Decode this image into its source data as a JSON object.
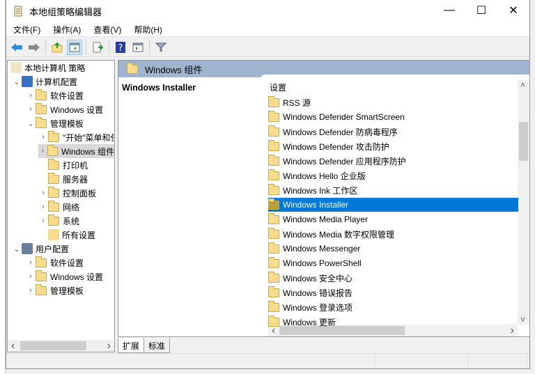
{
  "window": {
    "title": "本地组策略编辑器",
    "minimize": "—",
    "maximize": "☐",
    "close": "✕"
  },
  "menu": [
    "文件(F)",
    "操作(A)",
    "查看(V)",
    "帮助(H)"
  ],
  "toolbar": [
    "back-icon",
    "forward-icon",
    "up-folder-icon",
    "show-hide-tree-icon",
    "export-list-icon",
    "help-icon",
    "show-action-pane-icon",
    "filter-icon"
  ],
  "tree": [
    {
      "label": "本地计算机 策略",
      "level": 0,
      "chev": "",
      "icon": "policy"
    },
    {
      "label": "计算机配置",
      "level": 1,
      "chev": "⌄",
      "icon": "computer"
    },
    {
      "label": "软件设置",
      "level": 2,
      "chev": "›",
      "icon": "folder"
    },
    {
      "label": "Windows 设置",
      "level": 2,
      "chev": "›",
      "icon": "folder"
    },
    {
      "label": "管理模板",
      "level": 2,
      "chev": "⌄",
      "icon": "folder"
    },
    {
      "label": "\"开始\"菜单和任务栏",
      "level": 3,
      "chev": "›",
      "icon": "folder"
    },
    {
      "label": "Windows 组件",
      "level": 3,
      "chev": "›",
      "icon": "folder",
      "selected": true
    },
    {
      "label": "打印机",
      "level": 3,
      "chev": "",
      "icon": "folder"
    },
    {
      "label": "服务器",
      "level": 3,
      "chev": "",
      "icon": "folder"
    },
    {
      "label": "控制面板",
      "level": 3,
      "chev": "›",
      "icon": "folder"
    },
    {
      "label": "网络",
      "level": 3,
      "chev": "›",
      "icon": "folder"
    },
    {
      "label": "系统",
      "level": 3,
      "chev": "›",
      "icon": "folder"
    },
    {
      "label": "所有设置",
      "level": 3,
      "chev": "",
      "icon": "settings"
    },
    {
      "label": "用户配置",
      "level": 1,
      "chev": "⌄",
      "icon": "user"
    },
    {
      "label": "软件设置",
      "level": 2,
      "chev": "›",
      "icon": "folder"
    },
    {
      "label": "Windows 设置",
      "level": 2,
      "chev": "›",
      "icon": "folder"
    },
    {
      "label": "管理模板",
      "level": 2,
      "chev": "›",
      "icon": "folder"
    }
  ],
  "right": {
    "header": "Windows 组件",
    "description_title": "Windows Installer",
    "column": "设置",
    "items": [
      "RSS 源",
      "Windows Defender SmartScreen",
      "Windows Defender 防病毒程序",
      "Windows Defender 攻击防护",
      "Windows Defender 应用程序防护",
      "Windows Hello 企业版",
      "Windows Ink 工作区",
      "Windows Installer",
      "Windows Media Player",
      "Windows Media 数字权限管理",
      "Windows Messenger",
      "Windows PowerShell",
      "Windows 安全中心",
      "Windows 错误报告",
      "Windows 登录选项",
      "Windows 更新"
    ],
    "selected_index": 7
  },
  "tabs": [
    "扩展",
    "标准"
  ],
  "scroll": {
    "left": "‹",
    "right": "›",
    "up": "˄",
    "down": "˅"
  }
}
